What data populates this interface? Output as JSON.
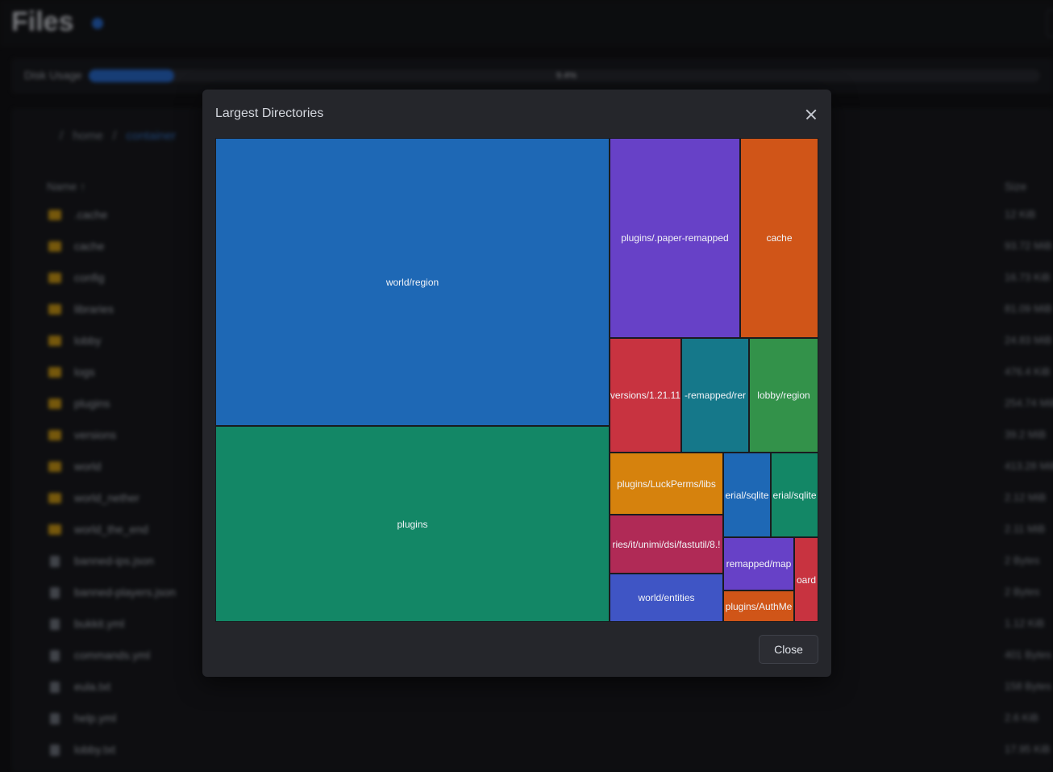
{
  "page": {
    "title": "Files",
    "disk": {
      "label": "Disk Usage",
      "percent": 0.09,
      "percent_text": "9.4%"
    },
    "breadcrumb": {
      "root": "home",
      "current": "container"
    },
    "columns": {
      "name": "Name",
      "size": "Size"
    },
    "rows": [
      {
        "type": "folder",
        "name": ".cache",
        "size": "12 KiB"
      },
      {
        "type": "folder",
        "name": "cache",
        "size": "93.72 MiB"
      },
      {
        "type": "folder",
        "name": "config",
        "size": "16.73 KiB"
      },
      {
        "type": "folder",
        "name": "libraries",
        "size": "81.09 MiB"
      },
      {
        "type": "folder",
        "name": "lobby",
        "size": "24.83 MiB"
      },
      {
        "type": "folder",
        "name": "logs",
        "size": "476.4 KiB"
      },
      {
        "type": "folder",
        "name": "plugins",
        "size": "254.74 MiB"
      },
      {
        "type": "folder",
        "name": "versions",
        "size": "39.2 MiB"
      },
      {
        "type": "folder",
        "name": "world",
        "size": "413.28 MiB"
      },
      {
        "type": "folder",
        "name": "world_nether",
        "size": "2.12 MiB"
      },
      {
        "type": "folder",
        "name": "world_the_end",
        "size": "2.11 MiB"
      },
      {
        "type": "file",
        "name": "banned-ips.json",
        "size": "2 Bytes"
      },
      {
        "type": "file",
        "name": "banned-players.json",
        "size": "2 Bytes"
      },
      {
        "type": "file",
        "name": "bukkit.yml",
        "size": "1.12 KiB"
      },
      {
        "type": "file",
        "name": "commands.yml",
        "size": "401 Bytes"
      },
      {
        "type": "file",
        "name": "eula.txt",
        "size": "158 Bytes"
      },
      {
        "type": "file",
        "name": "help.yml",
        "size": "2.6 KiB"
      },
      {
        "type": "file",
        "name": "lobby.txt",
        "size": "17.95 KiB"
      }
    ]
  },
  "modal": {
    "title": "Largest Directories",
    "close_label": "Close",
    "colors": {
      "blue": "#1e68b5",
      "green": "#138766",
      "purple": "#6741c7",
      "orange": "#d05518",
      "red": "#c83340",
      "teal": "#15788a",
      "grassgreen": "#33924a",
      "amber": "#d6820d",
      "crimson": "#b02a56",
      "indigo": "#3f55c5"
    }
  },
  "chart_data": {
    "type": "treemap",
    "title": "Largest Directories",
    "tiles": [
      {
        "label": "world/region",
        "color": "#1e68b5"
      },
      {
        "label": "plugins",
        "color": "#138766"
      },
      {
        "label": "plugins/.paper-remapped",
        "color": "#6741c7"
      },
      {
        "label": "cache",
        "color": "#d05518"
      },
      {
        "label": "versions/1.21.11",
        "color": "#c83340"
      },
      {
        "label": "-remapped/rer",
        "color": "#15788a"
      },
      {
        "label": "lobby/region",
        "color": "#33924a"
      },
      {
        "label": "plugins/LuckPerms/libs",
        "color": "#d6820d"
      },
      {
        "label": "erial/sqlite",
        "color": "#1e68b5"
      },
      {
        "label": "erial/sqlite",
        "color": "#138766"
      },
      {
        "label": "ries/it/unimi/dsi/fastutil/8.!",
        "color": "#b02a56"
      },
      {
        "label": "remapped/map",
        "color": "#6741c7"
      },
      {
        "label": "oard",
        "color": "#c83340"
      },
      {
        "label": "world/entities",
        "color": "#3f55c5"
      },
      {
        "label": "plugins/AuthMe",
        "color": "#d05518"
      }
    ]
  }
}
